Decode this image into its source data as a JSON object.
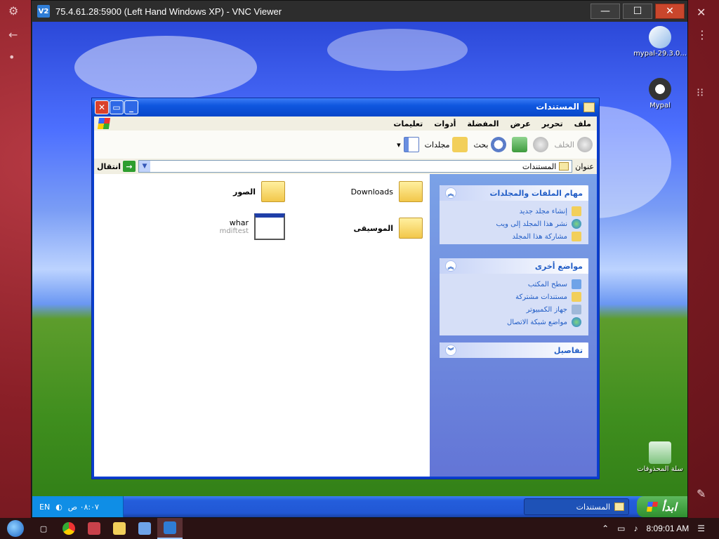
{
  "vnc": {
    "title": "75.4.61.28:5900 (Left Hand Windows XP) - VNC Viewer",
    "logo": "V2",
    "min": "—",
    "max": "☐",
    "close": "✕"
  },
  "desktop_icons": [
    {
      "label": "mypal-29.3.0..."
    },
    {
      "label": "Mypal"
    },
    {
      "label": "سلة المحذوفات"
    }
  ],
  "explorer": {
    "title": "المستندات",
    "menu": [
      "ملف",
      "تحرير",
      "عرض",
      "المفضلة",
      "أدوات",
      "تعليمات"
    ],
    "toolbar": {
      "back": "الخلف",
      "search": "بحث",
      "folders": "مجلدات"
    },
    "address": {
      "label": "عنوان",
      "value": "المستندات",
      "go": "انتقال"
    },
    "tasks": {
      "title": "مهام الملفات والمجلدات",
      "items": [
        "إنشاء مجلد جديد",
        "نشر هذا المجلد إلى ويب",
        "مشاركة هذا المجلد"
      ]
    },
    "other_places": {
      "title": "مواضع أخرى",
      "items": [
        "سطح المكتب",
        "مستندات مشتركة",
        "جهاز الكمبيوتر",
        "مواضع شبكة الاتصال"
      ]
    },
    "details": {
      "title": "تفاصيل"
    },
    "files": [
      {
        "name": "Downloads"
      },
      {
        "name": "الصور"
      },
      {
        "name": "الموسيقى"
      },
      {
        "name": "whar",
        "sub": "mdiftest"
      }
    ]
  },
  "xp_taskbar": {
    "start": "ابدأ",
    "task": "المستندات",
    "lang": "EN",
    "clock": "٠٨:٠٧ ص"
  },
  "host_taskbar": {
    "time": "8:09:01 AM"
  },
  "colors": {
    "xp_blue": "#0a3ecf",
    "taskpane_link": "#215dc6",
    "host_bg": "#7a1d22"
  }
}
